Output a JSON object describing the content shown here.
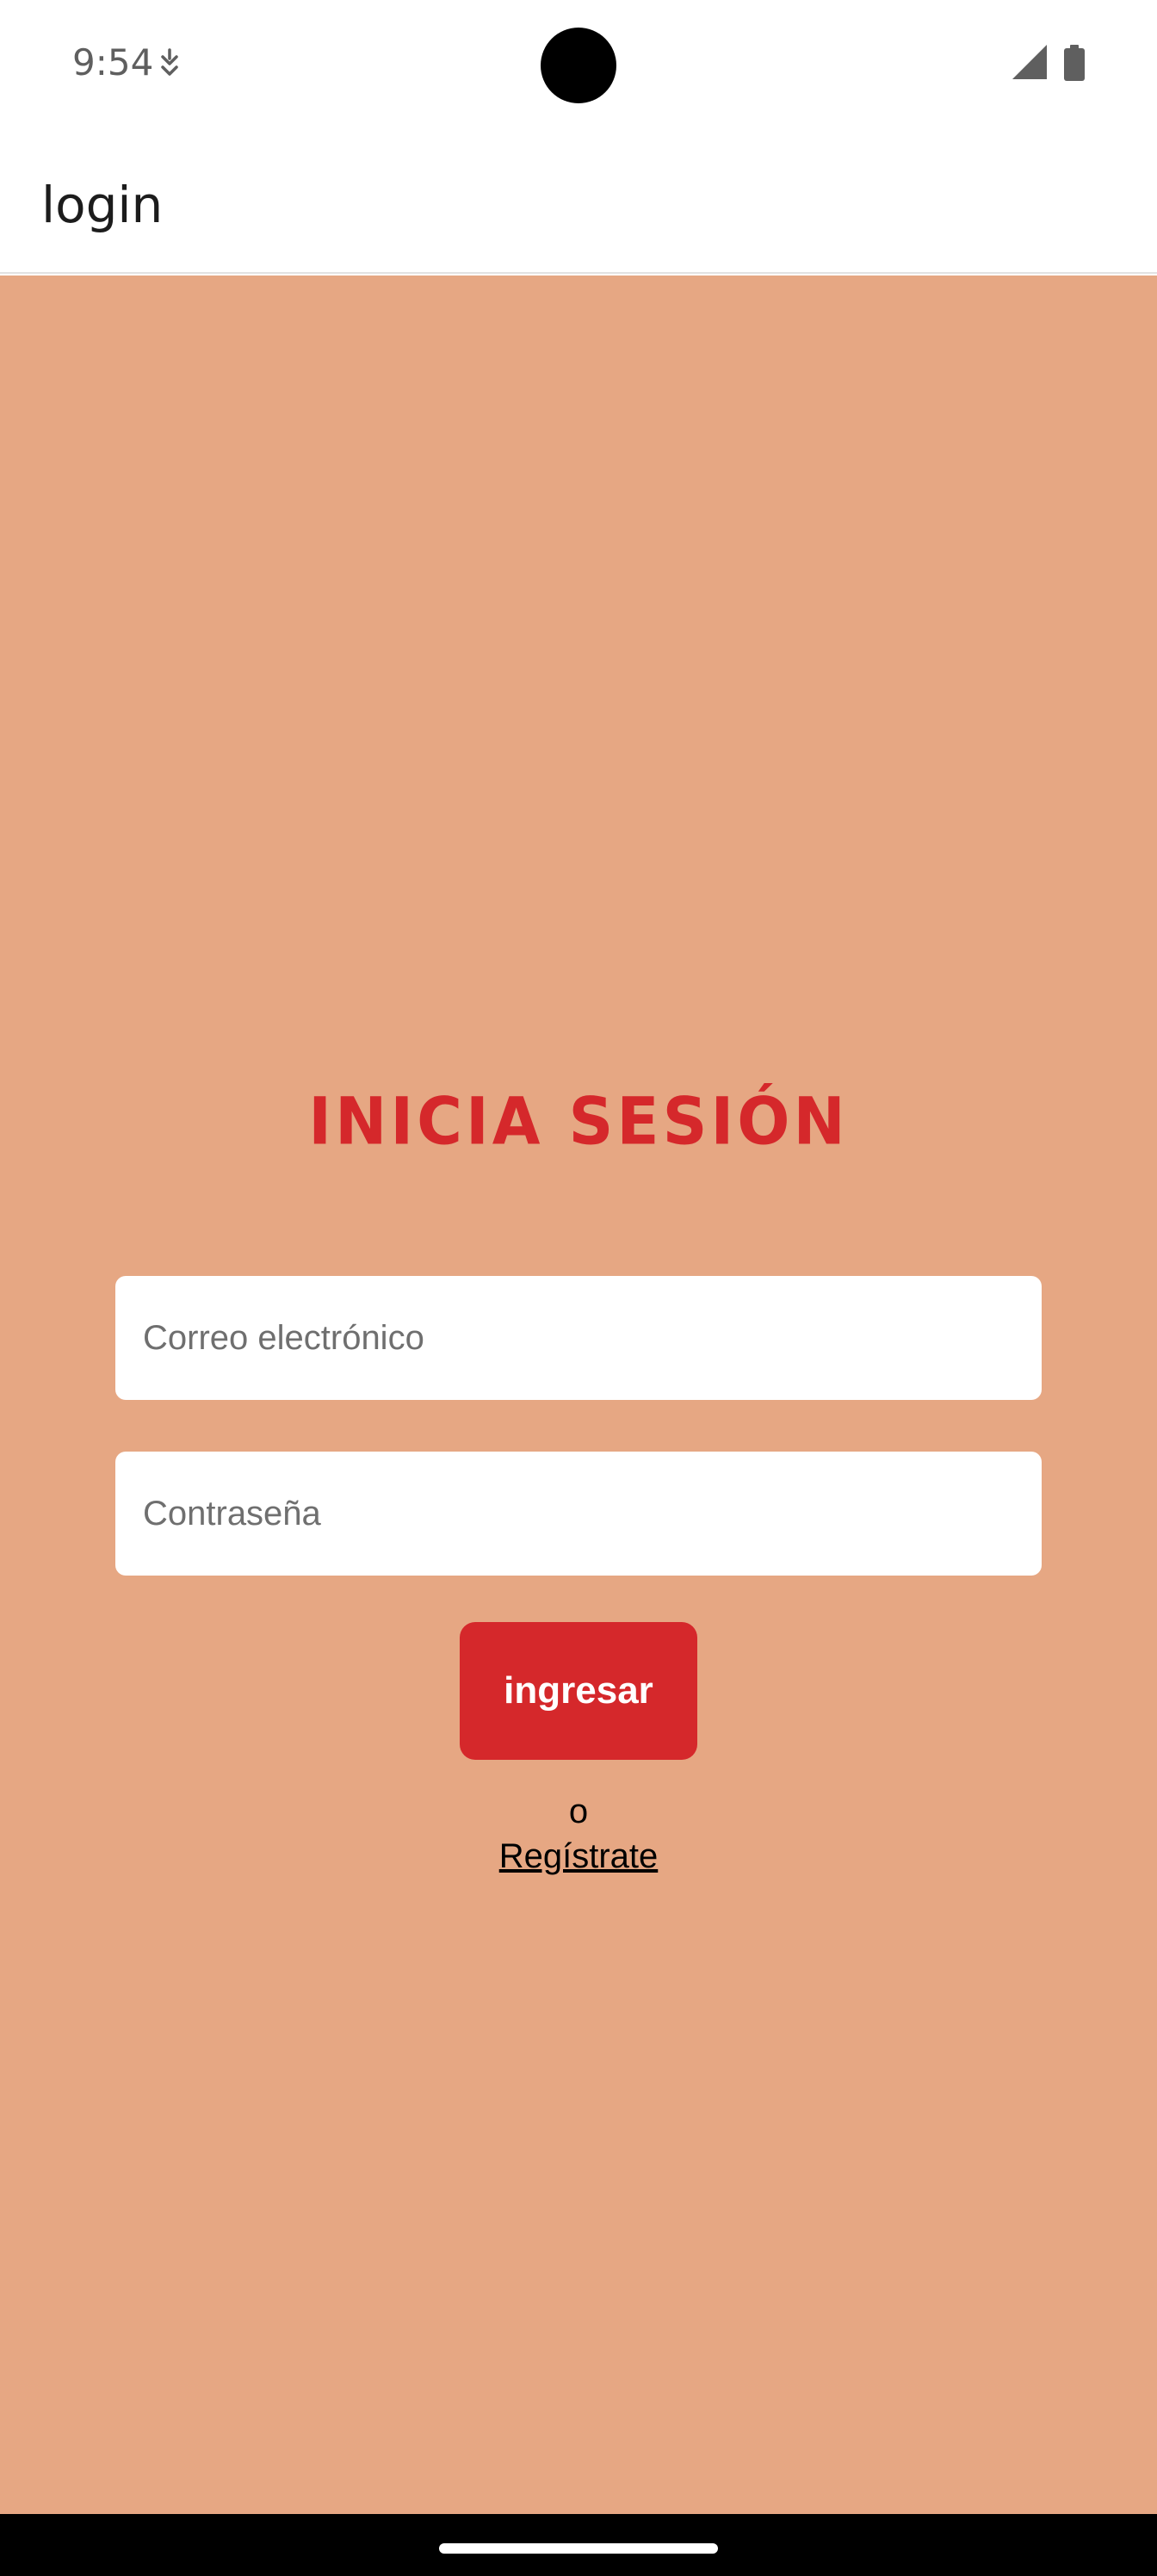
{
  "status_bar": {
    "time": "9:54",
    "app_icon": "notification-app-icon",
    "signal_icon": "cell-signal-icon",
    "battery_icon": "battery-icon"
  },
  "app_bar": {
    "title": "login"
  },
  "login": {
    "heading": "INICIA SESIÓN",
    "email_placeholder": "Correo electrónico",
    "password_placeholder": "Contraseña",
    "submit_label": "ingresar",
    "or_text": "o",
    "register_label": "Regístrate"
  },
  "colors": {
    "background": "#e6a783",
    "accent": "#d5282b",
    "input_background": "#ffffff"
  }
}
